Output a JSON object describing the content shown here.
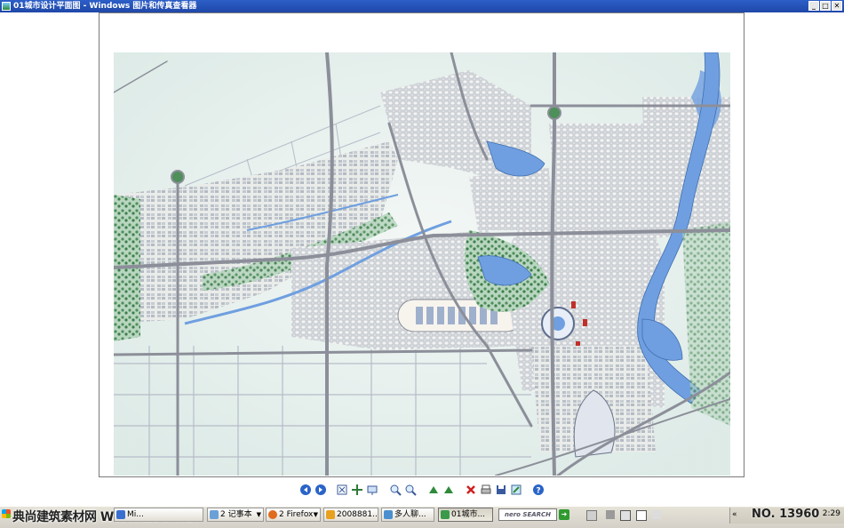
{
  "window": {
    "title": "01城市设计平面图 - Windows 图片和传真查看器",
    "minimize": "_",
    "maximize": "□",
    "close": "✕"
  },
  "toolbar": {
    "buttons": [
      {
        "name": "previous-image-button",
        "icon": "previous-icon"
      },
      {
        "name": "next-image-button",
        "icon": "next-icon"
      },
      {
        "name": "best-fit-button",
        "icon": "best-fit-icon"
      },
      {
        "name": "actual-size-button",
        "icon": "actual-size-icon"
      },
      {
        "name": "slideshow-button",
        "icon": "slideshow-icon"
      },
      {
        "name": "zoom-in-button",
        "icon": "zoom-in-icon"
      },
      {
        "name": "zoom-out-button",
        "icon": "zoom-out-icon"
      },
      {
        "name": "rotate-clockwise-button",
        "icon": "rotate-clockwise-icon"
      },
      {
        "name": "rotate-counterclockwise-button",
        "icon": "rotate-counterclockwise-icon"
      },
      {
        "name": "delete-button",
        "icon": "delete-icon"
      },
      {
        "name": "print-button",
        "icon": "print-icon"
      },
      {
        "name": "save-button",
        "icon": "save-icon"
      },
      {
        "name": "open-editor-button",
        "icon": "edit-icon"
      },
      {
        "name": "help-button",
        "icon": "help-icon"
      }
    ]
  },
  "taskbar": {
    "watermark": "典尚建筑素材网 WWW.ZSO.NET",
    "items": [
      {
        "label": "Mi...",
        "icon_color": "#3a6fd0"
      },
      {
        "label": "2 记事本",
        "icon_color": "#6aa0d8"
      },
      {
        "label": "2 Firefox",
        "icon_color": "#e06a1e"
      },
      {
        "label": "2008881...",
        "icon_color": "#e8a020"
      },
      {
        "label": "多人聊...",
        "icon_color": "#4a90d0"
      },
      {
        "label": "01城市...",
        "icon_color": "#3a9a4a"
      }
    ],
    "search_brand": "nero SEARCH",
    "tray_text": "NO. 13960",
    "clock": "2:29"
  },
  "colors": {
    "titlebar": "#1f47a8",
    "water": "#6f9fe0",
    "green": "#4f8f5a",
    "road": "#8c8f99"
  }
}
